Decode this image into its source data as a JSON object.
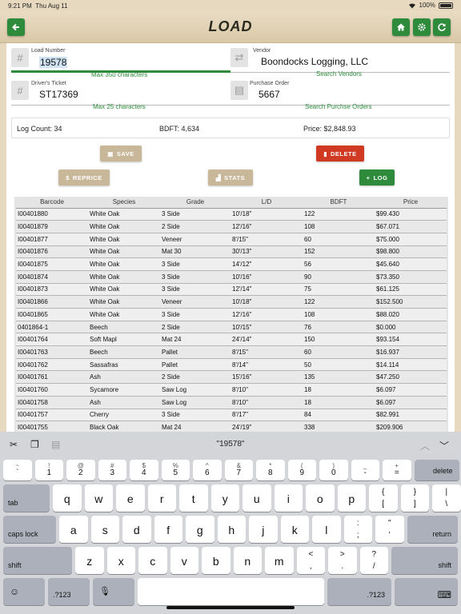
{
  "status": {
    "time": "9:21 PM",
    "date": "Thu Aug 11",
    "battery": "100%"
  },
  "nav": {
    "title": "LOAD"
  },
  "form": {
    "load_number": {
      "label": "Load Number",
      "value": "19578",
      "hint": "Max 350 characters"
    },
    "vendor": {
      "label": "Vendor",
      "value": "Boondocks Logging, LLC",
      "hint": "Search Vendors"
    },
    "drivers_ticket": {
      "label": "Driver's Ticket",
      "value": "ST17369",
      "hint": "Max 25 characters"
    },
    "purchase_order": {
      "label": "Purchase Order",
      "value": "5667",
      "hint": "Search Purchse Orders"
    }
  },
  "summary": {
    "log_count": "Log Count: 34",
    "bdft": "BDFT: 4,634",
    "price": "Price: $2,848.93"
  },
  "buttons": {
    "save": "SAVE",
    "delete": "DELETE",
    "reprice": "REPRICE",
    "stats": "STATS",
    "log": "LOG"
  },
  "table": {
    "headers": [
      "Barcode",
      "Species",
      "Grade",
      "L/D",
      "BDFT",
      "Price"
    ],
    "rows": [
      [
        "I00401880",
        "White Oak",
        "3 Side",
        "10'/18\"",
        "122",
        "$99.430"
      ],
      [
        "I00401879",
        "White Oak",
        "2 Side",
        "12'/16\"",
        "108",
        "$67.071"
      ],
      [
        "I00401877",
        "White Oak",
        "Veneer",
        "8'/15\"",
        "60",
        "$75.000"
      ],
      [
        "I00401876",
        "White Oak",
        "Mat 30",
        "30'/13\"",
        "152",
        "$98.800"
      ],
      [
        "I00401875",
        "White Oak",
        "3 Side",
        "14'/12\"",
        "56",
        "$45.640"
      ],
      [
        "I00401874",
        "White Oak",
        "3 Side",
        "10'/16\"",
        "90",
        "$73.350"
      ],
      [
        "I00401873",
        "White Oak",
        "3 Side",
        "12'/14\"",
        "75",
        "$61.125"
      ],
      [
        "I00401866",
        "White Oak",
        "Veneer",
        "10'/18\"",
        "122",
        "$152.500"
      ],
      [
        "I00401865",
        "White Oak",
        "3 Side",
        "12'/16\"",
        "108",
        "$88.020"
      ],
      [
        "0401864-1",
        "Beech",
        "2 Side",
        "10'/15\"",
        "76",
        "$0.000"
      ],
      [
        "I00401764",
        "Soft Mapl",
        "Mat 24",
        "24'/14\"",
        "150",
        "$93.154"
      ],
      [
        "I00401763",
        "Beech",
        "Pallet",
        "8'/15\"",
        "60",
        "$16.937"
      ],
      [
        "I00401762",
        "Sassafras",
        "Pallet",
        "8'/14\"",
        "50",
        "$14.114"
      ],
      [
        "I00401761",
        "Ash",
        "2 Side",
        "15'/16\"",
        "135",
        "$47.250"
      ],
      [
        "I00401760",
        "Sycamore",
        "Saw Log",
        "8'/10\"",
        "18",
        "$6.097"
      ],
      [
        "I00401758",
        "Ash",
        "Saw Log",
        "8'/10\"",
        "18",
        "$6.097"
      ],
      [
        "I00401757",
        "Cherry",
        "3 Side",
        "8'/17\"",
        "84",
        "$82.991"
      ],
      [
        "I00401755",
        "Black Oak",
        "Mat 24",
        "24'/19\"",
        "338",
        "$209.906"
      ]
    ]
  },
  "keyboard": {
    "suggestion": "\"19578\"",
    "row1": [
      [
        "~",
        "`"
      ],
      [
        "!",
        "1"
      ],
      [
        "@",
        "2"
      ],
      [
        "#",
        "3"
      ],
      [
        "$",
        "4"
      ],
      [
        "%",
        "5"
      ],
      [
        "^",
        "6"
      ],
      [
        "&",
        "7"
      ],
      [
        "*",
        "8"
      ],
      [
        "(",
        "9"
      ],
      [
        ")",
        "0"
      ],
      [
        "_",
        "-"
      ],
      [
        "+",
        "="
      ]
    ],
    "row2": [
      "q",
      "w",
      "e",
      "r",
      "t",
      "y",
      "u",
      "i",
      "o",
      "p"
    ],
    "row2_brackets": [
      [
        "{",
        "["
      ],
      [
        "}",
        "]"
      ],
      [
        "|",
        "\\"
      ]
    ],
    "row3": [
      "a",
      "s",
      "d",
      "f",
      "g",
      "h",
      "j",
      "k",
      "l"
    ],
    "row3_punct": [
      [
        ":",
        ";"
      ],
      [
        "\"",
        "'"
      ]
    ],
    "row4": [
      "z",
      "x",
      "c",
      "v",
      "b",
      "n",
      "m"
    ],
    "row4_punct": [
      [
        "<",
        ","
      ],
      [
        ">",
        "."
      ],
      [
        "?",
        "/"
      ]
    ],
    "labels": {
      "delete": "delete",
      "tab": "tab",
      "caps": "caps lock",
      "return": "return",
      "shift": "shift",
      "num": ".?123"
    }
  }
}
